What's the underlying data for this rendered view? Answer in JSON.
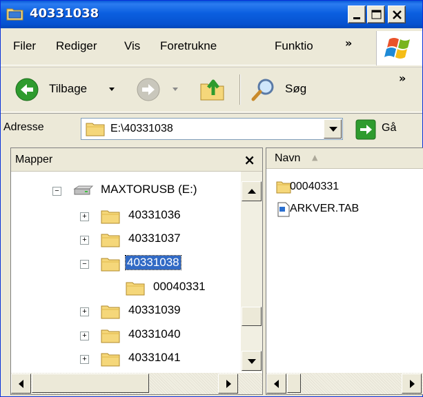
{
  "window": {
    "title": "40331038",
    "controls": {
      "minimize": "minimize",
      "maximize": "maximize",
      "close": "close"
    }
  },
  "menubar": {
    "items": [
      "Filer",
      "Rediger",
      "Vis",
      "Foretrukne",
      "Funktio"
    ],
    "overflow": "»"
  },
  "toolbar": {
    "back_label": "Tilbage",
    "search_label": "Søg",
    "overflow": "»"
  },
  "address": {
    "label": "Adresse",
    "value": "E:\\40331038",
    "go_label": "Gå"
  },
  "folders_pane": {
    "title": "Mapper",
    "close": "×",
    "tree": [
      {
        "label": "MAXTORUSB (E:)",
        "expander": "−",
        "icon": "drive-icon"
      },
      {
        "label": "40331036",
        "expander": "+",
        "icon": "folder-icon"
      },
      {
        "label": "40331037",
        "expander": "+",
        "icon": "folder-icon"
      },
      {
        "label": "40331038",
        "expander": "−",
        "icon": "folder-icon",
        "selected": true
      },
      {
        "label": "00040331",
        "expander": "",
        "icon": "folder-icon"
      },
      {
        "label": "40331039",
        "expander": "+",
        "icon": "folder-icon"
      },
      {
        "label": "40331040",
        "expander": "+",
        "icon": "folder-icon"
      },
      {
        "label": "40331041",
        "expander": "+",
        "icon": "folder-icon"
      }
    ]
  },
  "file_list": {
    "column": "Navn",
    "sort_indicator": "▲",
    "items": [
      {
        "name": "00040331",
        "icon": "folder-icon"
      },
      {
        "name": "ARKVER.TAB",
        "icon": "file-icon"
      }
    ]
  },
  "colors": {
    "titlebar": "#0b5fe0",
    "selection": "#316ac5",
    "chrome": "#ece9d8",
    "folder": "#f5d77a"
  }
}
